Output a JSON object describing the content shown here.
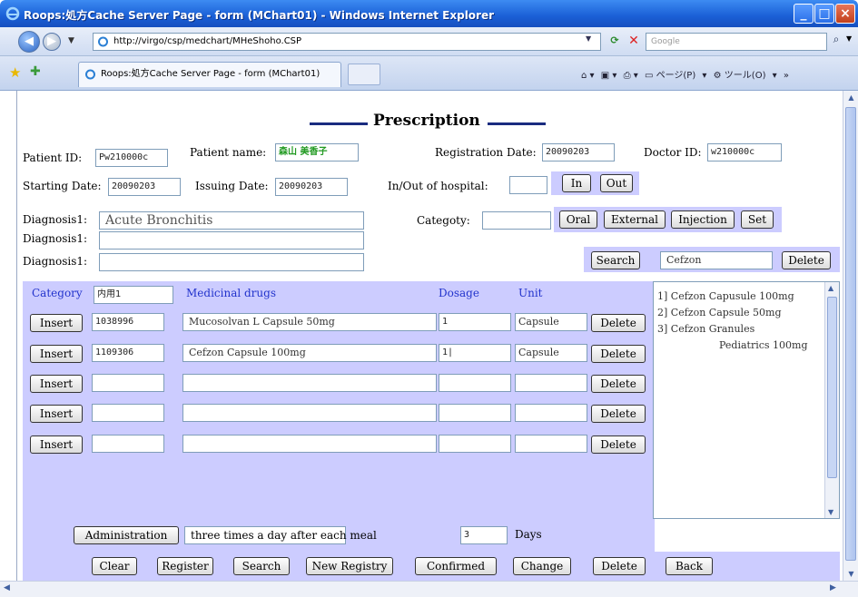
{
  "browser": {
    "window_title": "Roops:処方Cache Server Page - form (MChart01) - Windows Internet Explorer",
    "url": "http://virgo/csp/medchart/MHeShoho.CSP",
    "search_placeholder": "Google",
    "tab_title": "Roops:処方Cache Server Page - form (MChart01)",
    "command_bar": {
      "page": "ページ(P)",
      "tools": "ツール(O)"
    }
  },
  "form": {
    "heading": "Prescription",
    "patient_id_label": "Patient ID:",
    "patient_id": "Pw210000c",
    "patient_name_label": "Patient name:",
    "patient_name": "森山 美香子",
    "registration_date_label": "Registration Date:",
    "registration_date": "20090203",
    "doctor_id_label": "Doctor ID:",
    "doctor_id": "w210000c",
    "starting_date_label": "Starting Date:",
    "starting_date": "20090203",
    "issuing_date_label": "Issuing Date:",
    "issuing_date": "20090203",
    "in_out_label": "In/Out of hospital:",
    "in_out_value": "",
    "in_button": "In",
    "out_button": "Out",
    "diagnosis_label": "Diagnosis1:",
    "diagnoses": [
      "Acute Bronchitis",
      "",
      ""
    ],
    "category_label": "Categoty:",
    "category_value": "",
    "category_buttons": [
      "Oral",
      "External",
      "Injection",
      "Set"
    ],
    "search_button": "Search",
    "search_value": "Cefzon",
    "search_delete_button": "Delete"
  },
  "table": {
    "category_label": "Category",
    "category_value": "内用1",
    "columns": {
      "drugs": "Medicinal drugs",
      "dosage": "Dosage",
      "unit": "Unit"
    },
    "insert_label": "Insert",
    "delete_label": "Delete",
    "rows": [
      {
        "code": "1038996",
        "drug": "Mucosolvan L Capsule 50mg",
        "dosage": "1",
        "unit": "Capsule"
      },
      {
        "code": "1109306",
        "drug": "Cefzon Capsule 100mg",
        "dosage": "1|",
        "unit": "Capsule"
      },
      {
        "code": "",
        "drug": "",
        "dosage": "",
        "unit": ""
      },
      {
        "code": "",
        "drug": "",
        "dosage": "",
        "unit": ""
      },
      {
        "code": "",
        "drug": "",
        "dosage": "",
        "unit": ""
      }
    ],
    "results": [
      "1] Cefzon Capusule 100mg",
      "2] Cefzon Capsule 50mg",
      "3] Cefzon Granules",
      "Pediatrics 100mg"
    ],
    "administration_button": "Administration",
    "administration_value": "three times a day after each meal",
    "days_value": "3",
    "days_label": "Days"
  },
  "footer_buttons": [
    "Clear",
    "Register",
    "Search",
    "New Registry",
    "Confirmed",
    "Change",
    "Delete",
    "Back"
  ]
}
